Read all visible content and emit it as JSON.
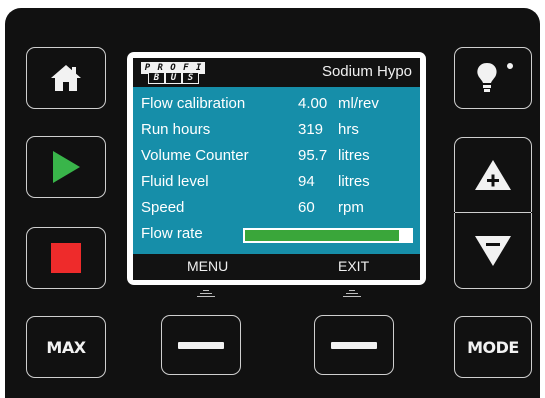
{
  "colors": {
    "panel": "#111111",
    "screen_blue": "#168ea9",
    "play_green": "#39b54a",
    "stop_red": "#ee2b2b",
    "bar_green": "#3aa63a",
    "bezel": "#cfcfcf"
  },
  "header": {
    "logo_line1": [
      "P",
      "R",
      "O",
      "F",
      "I"
    ],
    "logo_line2": [
      "B",
      "U",
      "S"
    ],
    "title": "Sodium Hypo"
  },
  "rows": [
    {
      "label": "Flow calibration",
      "value": "4.00",
      "unit": "ml/rev"
    },
    {
      "label": "Run hours",
      "value": "319",
      "unit": "hrs"
    },
    {
      "label": "Volume Counter",
      "value": "95.7",
      "unit": "litres"
    },
    {
      "label": "Fluid level",
      "value": "94",
      "unit": "litres"
    },
    {
      "label": "Speed",
      "value": "60",
      "unit": "rpm"
    }
  ],
  "flow_rate": {
    "label": "Flow rate",
    "level_fraction": 0.93
  },
  "softkeys": {
    "left": "MENU",
    "right": "EXIT"
  },
  "buttons": {
    "max": "MAX",
    "mode": "MODE",
    "icons": [
      "home-icon",
      "play-icon",
      "stop-icon",
      "lightbulb-icon",
      "plus-triangle-icon",
      "minus-triangle-icon",
      "dash-icon"
    ]
  }
}
